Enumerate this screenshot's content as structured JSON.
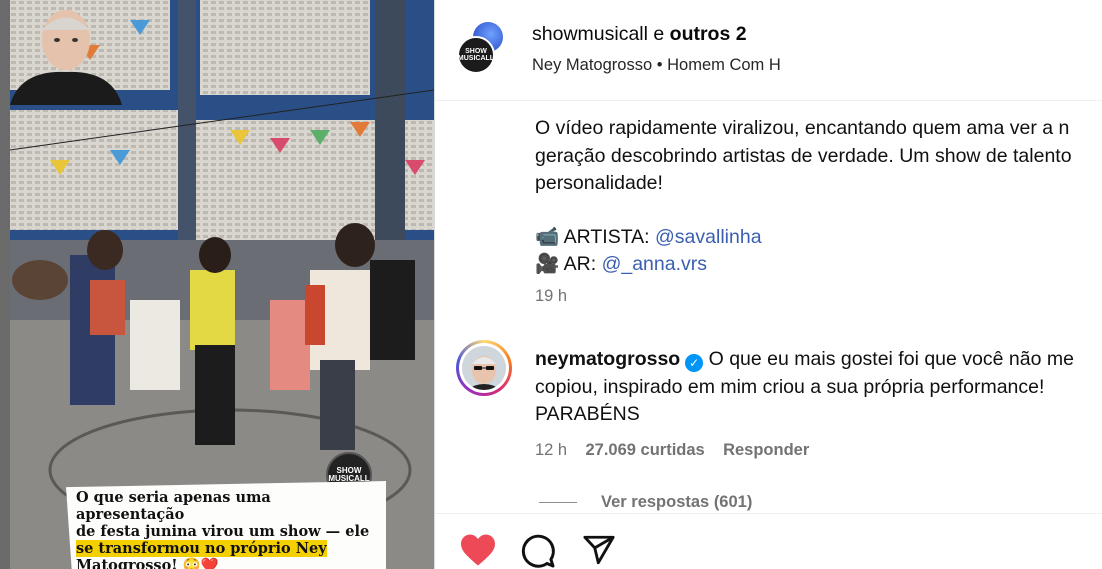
{
  "post": {
    "authors_primary": "showmusicall",
    "authors_connector": "e",
    "authors_others": "outros 2",
    "audio_artist": "Ney Matogrosso",
    "audio_separator": "•",
    "audio_track": "Homem Com H"
  },
  "media": {
    "logo_text": "SHOW MUSICALL",
    "caption_line1": "O que seria apenas uma apresentação",
    "caption_line2": "de festa junina virou um show — ele",
    "caption_highlight": "se transformou no próprio Ney",
    "caption_line4": "Matogrosso! 😳❤️"
  },
  "caption": {
    "line1": "O vídeo rapidamente viralizou, encantando quem ama ver a n",
    "line2": "geração descobrindo artistas de verdade. Um show de talento",
    "line3": "personalidade!",
    "artist_emoji": "📹",
    "artist_label": "ARTISTA:",
    "artist_link": "@savallinha",
    "ar_emoji": "🎥",
    "ar_label": "AR:",
    "ar_link": "@_anna.vrs",
    "time": "19 h"
  },
  "comment": {
    "username": "neymatogrosso",
    "text_line1": "O que eu mais gostei foi que você não me",
    "text_line2": "copiou, inspirado em mim criou a sua própria performance!",
    "text_line3": "PARABÉNS",
    "time": "12 h",
    "likes": "27.069 curtidas",
    "reply": "Responder",
    "view_replies": "Ver respostas (601)"
  },
  "actions": {
    "like_icon": "heart-filled-icon",
    "comment_icon": "comment-bubble-icon",
    "share_icon": "paper-plane-icon",
    "like_color": "#ed4956"
  },
  "colors": {
    "link": "#3b5fb0",
    "secondary_text": "#737373",
    "verified": "#0095f6",
    "caption_highlight": "#f5d000"
  }
}
